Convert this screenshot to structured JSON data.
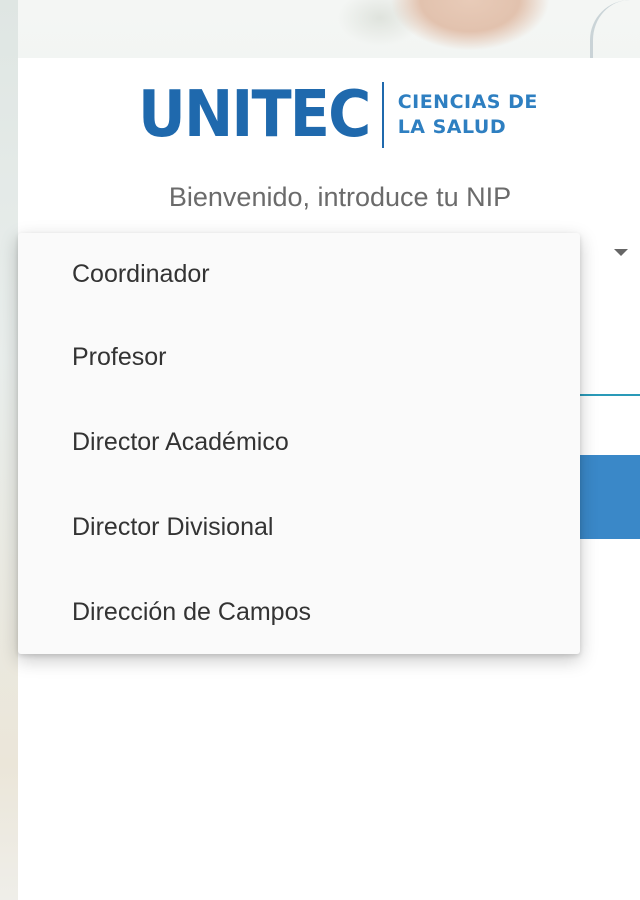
{
  "logo": {
    "wordmark": "UNITEC",
    "subtitle_line1": "CIENCIAS DE",
    "subtitle_line2": "LA SALUD"
  },
  "welcome_text": "Bienvenido, introduce tu NIP",
  "role_dropdown": {
    "options": [
      "Coordinador",
      "Profesor",
      "Director Académico",
      "Director Divisional",
      "Dirección de Campos"
    ]
  },
  "colors": {
    "brand_blue": "#1f69ad",
    "button_blue": "#3a88c8",
    "input_underline": "#2a9ab8"
  },
  "icons": {
    "dropdown_arrow": "chevron-down-icon"
  }
}
